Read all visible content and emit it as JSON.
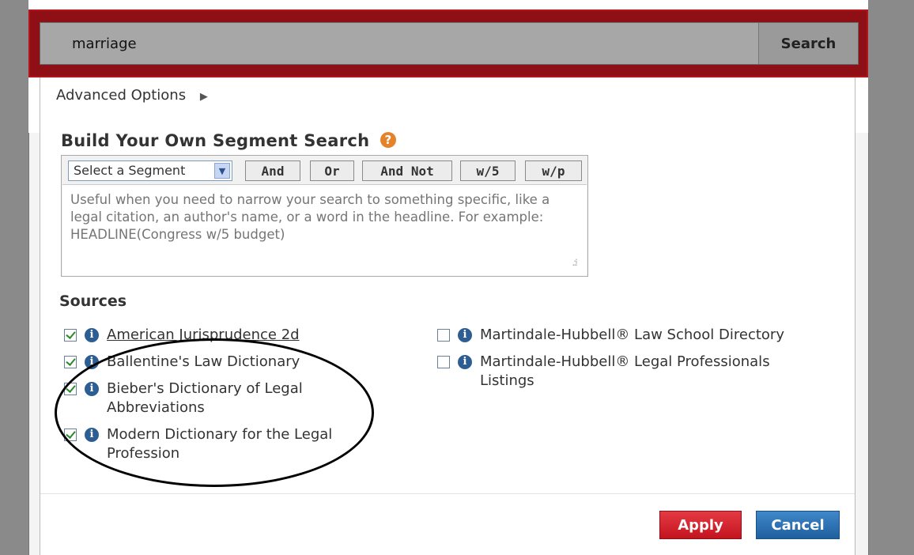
{
  "search": {
    "value": "marriage",
    "button_label": "Search"
  },
  "advanced_options": {
    "label": "Advanced Options",
    "arrow": "▶"
  },
  "segment_search": {
    "title": "Build Your Own Segment Search",
    "help_icon": "?",
    "select_value": "Select a Segment",
    "select_arrow": "▼",
    "operators": [
      "And",
      "Or",
      "And Not",
      "w/5",
      "w/p"
    ],
    "placeholder": "Useful when you need to narrow your search to something specific, like a legal citation, an author's name, or a word in the headline. For example: HEADLINE(Congress w/5 budget)"
  },
  "sources": {
    "title": "Sources",
    "info_glyph": "i",
    "items": [
      {
        "label": "American Jurisprudence 2d",
        "checked": true
      },
      {
        "label": "Ballentine's Law Dictionary",
        "checked": true
      },
      {
        "label": "Bieber's Dictionary of Legal",
        "label_line2": "Abbreviations",
        "checked": true
      },
      {
        "label": "Modern Dictionary for the Legal",
        "label_line2": "Profession",
        "checked": true
      },
      {
        "label": "Martindale-Hubbell® Law School Directory",
        "checked": false
      },
      {
        "label": "Martindale-Hubbell® Legal Professionals",
        "label_line2": "Listings",
        "checked": false
      }
    ]
  },
  "footer": {
    "apply_label": "Apply",
    "cancel_label": "Cancel"
  },
  "colors": {
    "search_frame": "#8f0f16",
    "apply_button": "#d11d28",
    "cancel_button": "#2a6fb0",
    "info_icon": "#2c5e94",
    "help_icon": "#e4832b"
  },
  "icons": {
    "search": "search-icon",
    "help": "help-icon",
    "info": "info-icon",
    "dropdown": "chevron-down-icon",
    "expand": "triangle-right-icon"
  }
}
